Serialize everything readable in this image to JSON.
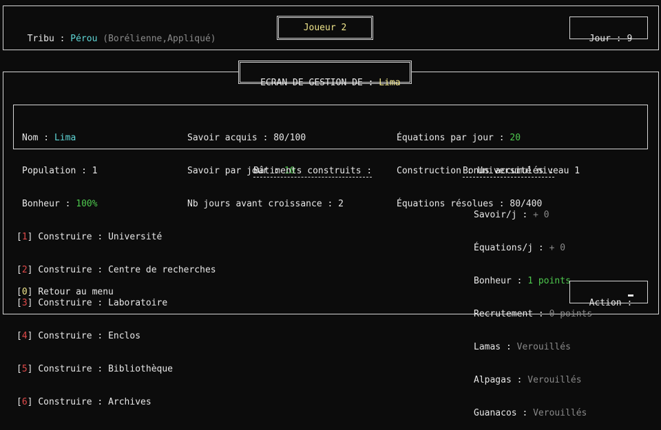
{
  "header": {
    "tribe_label": "Tribu",
    "tribe_name": "Pérou",
    "tribe_traits": "(Borélienne,Appliqué)",
    "player": "Joueur 2",
    "day_label": "Jour",
    "day_value": "9"
  },
  "screen_title_prefix": "ECRAN DE GESTION DE",
  "screen_title_city": "Lima",
  "stats": {
    "name_label": "Nom",
    "name_value": "Lima",
    "population_label": "Population",
    "population_value": "1",
    "happiness_label": "Bonheur",
    "happiness_value": "100%",
    "knowledge_label": "Savoir acquis",
    "knowledge_value": "80/100",
    "knowledge_day_label": "Savoir par jour",
    "knowledge_day_value": "10",
    "growth_label": "Nb jours avant croissance",
    "growth_value": "2",
    "equations_day_label": "Équations par jour",
    "equations_day_value": "20",
    "construction_label": "Construction",
    "construction_value": "Université niveau 1",
    "equations_solved_label": "Équations résolues",
    "equations_solved_value": "80/400"
  },
  "buildings_title": "Bâtiments construits :",
  "bonus_title": "Bonus accumulés :",
  "bonuses": [
    {
      "label": "Savoir/j",
      "value": "+ 0",
      "color": "grey"
    },
    {
      "label": "Équations/j",
      "value": "+ 0",
      "color": "grey"
    },
    {
      "label": "Bonheur",
      "value": "1 points",
      "color": "green"
    },
    {
      "label": "Recrutement",
      "value": "0 points",
      "color": "grey"
    },
    {
      "label": "Lamas",
      "value": "Verouillés",
      "color": "grey"
    },
    {
      "label": "Alpagas",
      "value": "Verouillés",
      "color": "grey"
    },
    {
      "label": "Guanacos",
      "value": "Verouillés",
      "color": "grey"
    }
  ],
  "menu": [
    {
      "key": "1",
      "action": "Construire",
      "target": "Université"
    },
    {
      "key": "2",
      "action": "Construire",
      "target": "Centre de recherches"
    },
    {
      "key": "3",
      "action": "Construire",
      "target": "Laboratoire"
    },
    {
      "key": "4",
      "action": "Construire",
      "target": "Enclos"
    },
    {
      "key": "5",
      "action": "Construire",
      "target": "Bibliothèque"
    },
    {
      "key": "6",
      "action": "Construire",
      "target": "Archives"
    }
  ],
  "back": {
    "key": "0",
    "label": "Retour au menu"
  },
  "action_label": "Action :"
}
